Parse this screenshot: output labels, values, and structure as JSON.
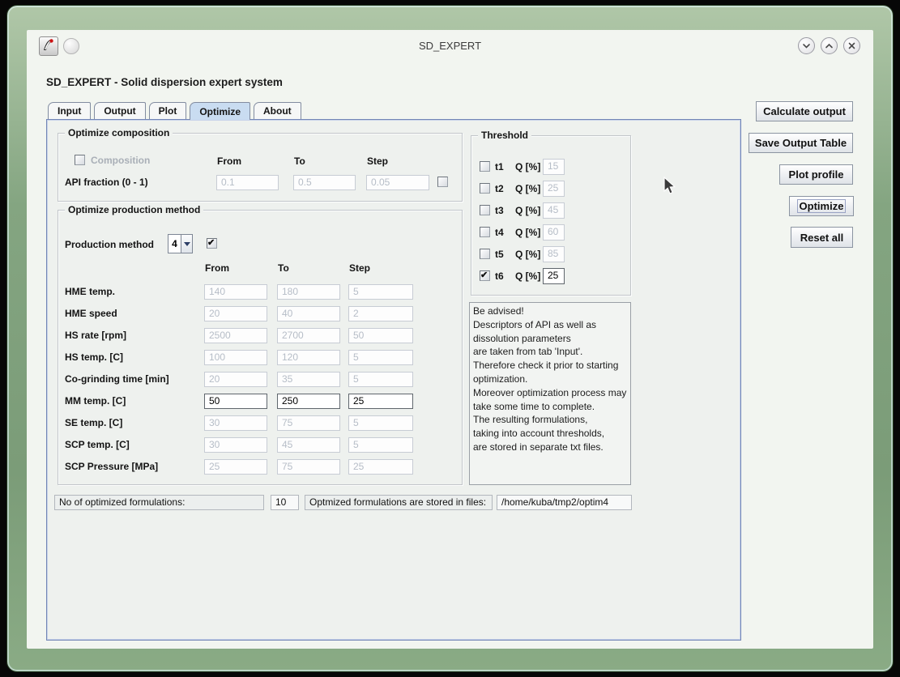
{
  "window": {
    "title": "SD_EXPERT",
    "heading": "SD_EXPERT - Solid dispersion expert system"
  },
  "icons": {
    "app_icon": "java-duke-icon",
    "check": "✔"
  },
  "tabs": [
    {
      "label": "Input"
    },
    {
      "label": "Output"
    },
    {
      "label": "Plot"
    },
    {
      "label": "Optimize",
      "selected": true
    },
    {
      "label": "About"
    }
  ],
  "composition_group": {
    "title": "Optimize composition",
    "checkbox_label": "Composition",
    "checkbox_checked": false,
    "headers": {
      "from": "From",
      "to": "To",
      "step": "Step"
    },
    "row_label": "API fraction (0 - 1)",
    "fields": {
      "from": "0.1",
      "to": "0.5",
      "step": "0.05"
    },
    "fields_enabled": false,
    "trailing_checkbox_checked": false
  },
  "production_group": {
    "title": "Optimize production method",
    "method_label": "Production method",
    "method_value": "4",
    "method_checked": true,
    "headers": {
      "from": "From",
      "to": "To",
      "step": "Step"
    },
    "rows": [
      {
        "label": "HME temp.",
        "from": "140",
        "to": "180",
        "step": "5",
        "enabled": false
      },
      {
        "label": "HME speed",
        "from": "20",
        "to": "40",
        "step": "2",
        "enabled": false
      },
      {
        "label": "HS rate [rpm]",
        "from": "2500",
        "to": "2700",
        "step": "50",
        "enabled": false
      },
      {
        "label": "HS temp. [C]",
        "from": "100",
        "to": "120",
        "step": "5",
        "enabled": false
      },
      {
        "label": "Co-grinding time [min]",
        "from": "20",
        "to": "35",
        "step": "5",
        "enabled": false
      },
      {
        "label": "MM temp. [C]",
        "from": "50",
        "to": "250",
        "step": "25",
        "enabled": true
      },
      {
        "label": "SE temp. [C]",
        "from": "30",
        "to": "75",
        "step": "5",
        "enabled": false
      },
      {
        "label": "SCP temp. [C]",
        "from": "30",
        "to": "45",
        "step": "5",
        "enabled": false
      },
      {
        "label": "SCP Pressure [MPa]",
        "from": "25",
        "to": "75",
        "step": "25",
        "enabled": false
      }
    ]
  },
  "threshold_group": {
    "title": "Threshold",
    "q_label": "Q [%]",
    "rows": [
      {
        "label": "t1",
        "value": "15",
        "checked": false
      },
      {
        "label": "t2",
        "value": "25",
        "checked": false
      },
      {
        "label": "t3",
        "value": "45",
        "checked": false
      },
      {
        "label": "t4",
        "value": "60",
        "checked": false
      },
      {
        "label": "t5",
        "value": "85",
        "checked": false
      },
      {
        "label": "t6",
        "value": "25",
        "checked": true
      }
    ]
  },
  "notice": {
    "text": "Be advised!\nDescriptors of API as well as\ndissolution parameters\nare taken from tab 'Input'.\nTherefore check it prior to starting\noptimization.\nMoreover optimization process may\ntake some time to complete.\nThe resulting formulations,\ntaking into account thresholds,\nare stored in separate txt files."
  },
  "status_bar": {
    "formulations_label": "No of optimized formulations:",
    "formulations_count": "10",
    "files_label": "Optmized formulations are stored in files:",
    "files_path": "/home/kuba/tmp2/optim4"
  },
  "action_buttons": {
    "calculate": "Calculate output",
    "save": "Save Output Table",
    "plot": "Plot profile",
    "optimize": "Optimize",
    "reset": "Reset all"
  },
  "colors": {
    "frame_green": "#84a581",
    "selected_tab": "#c9dcf1",
    "panel_border_blue": "#7285b5",
    "panel_bg": "#eef1ee"
  }
}
